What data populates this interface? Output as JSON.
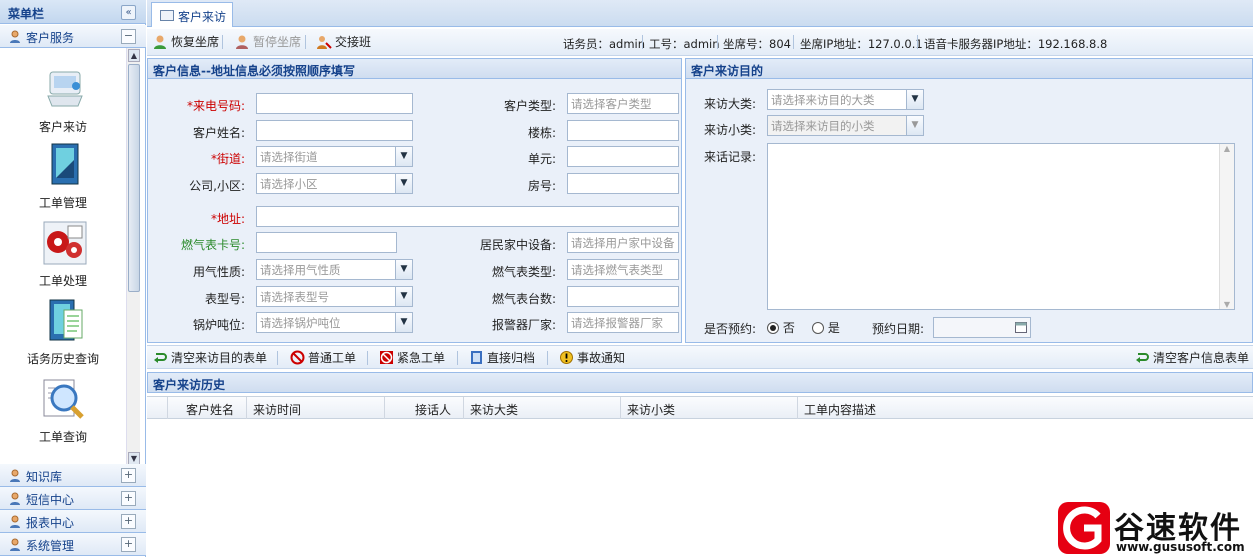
{
  "sidebar": {
    "title": "菜单栏",
    "collapse_icon": "«",
    "groups": [
      {
        "label": "客户服务",
        "toggle": "−"
      },
      {
        "label": "知识库",
        "toggle": "+"
      },
      {
        "label": "短信中心",
        "toggle": "+"
      },
      {
        "label": "报表中心",
        "toggle": "+"
      },
      {
        "label": "系统管理",
        "toggle": "+"
      }
    ],
    "items": [
      {
        "label": "客户来访",
        "icon": "phone-icon"
      },
      {
        "label": "工单管理",
        "icon": "document-icon"
      },
      {
        "label": "工单处理",
        "icon": "gears-icon"
      },
      {
        "label": "话务历史查询",
        "icon": "history-doc-icon"
      },
      {
        "label": "工单查询",
        "icon": "magnifier-icon"
      }
    ]
  },
  "tabs": [
    {
      "label": "客户来访"
    }
  ],
  "toolbar": {
    "resume": "恢复坐席",
    "pause": "暂停坐席",
    "handover": "交接班",
    "status_operator": "话务员：admin",
    "status_id": "工号：admin",
    "status_seat": "坐席号：804",
    "status_seat_ip": "坐席IP地址：127.0.0.1",
    "status_voice_ip": "语音卡服务器IP地址：192.168.8.8"
  },
  "customer_panel": {
    "title": "客户信息--地址信息必须按照顺序填写",
    "caller_label": "*来电号码:",
    "name_label": "客户姓名:",
    "street_label": "*街道:",
    "street_placeholder": "请选择街道",
    "community_label": "公司,小区:",
    "community_placeholder": "请选择小区",
    "address_label": "*地址:",
    "gas_card_label": "燃气表卡号:",
    "gas_nature_label": "用气性质:",
    "gas_nature_placeholder": "请选择用气性质",
    "meter_model_label": "表型号:",
    "meter_model_placeholder": "请选择表型号",
    "boiler_label": "锅炉吨位:",
    "boiler_placeholder": "请选择锅炉吨位",
    "cust_type_label": "客户类型:",
    "cust_type_placeholder": "请选择客户类型",
    "building_label": "楼栋:",
    "unit_label": "单元:",
    "room_label": "房号:",
    "home_device_label": "居民家中设备:",
    "home_device_placeholder": "请选择用户家中设备",
    "meter_type_label": "燃气表类型:",
    "meter_type_placeholder": "请选择燃气表类型",
    "meter_count_label": "燃气表台数:",
    "alarm_label": "报警器厂家:",
    "alarm_placeholder": "请选择报警器厂家"
  },
  "purpose_panel": {
    "title": "客户来访目的",
    "major_label": "来访大类:",
    "major_placeholder": "请选择来访目的大类",
    "minor_label": "来访小类:",
    "minor_placeholder": "请选择来访目的小类",
    "record_label": "来话记录:",
    "appointment_label": "是否预约:",
    "opt_no": "否",
    "opt_yes": "是",
    "date_label": "预约日期:"
  },
  "actions": {
    "clear_purpose": "清空来访目的表单",
    "normal_ticket": "普通工单",
    "urgent_ticket": "紧急工单",
    "archive": "直接归档",
    "incident": "事故通知",
    "clear_customer": "清空客户信息表单"
  },
  "history": {
    "title": "客户来访历史",
    "columns": [
      "客户姓名",
      "来访时间",
      "接话人",
      "来访大类",
      "来访小类",
      "工单内容描述"
    ]
  },
  "watermark": {
    "brand": "谷速软件",
    "url": "www.gususoft.com"
  }
}
